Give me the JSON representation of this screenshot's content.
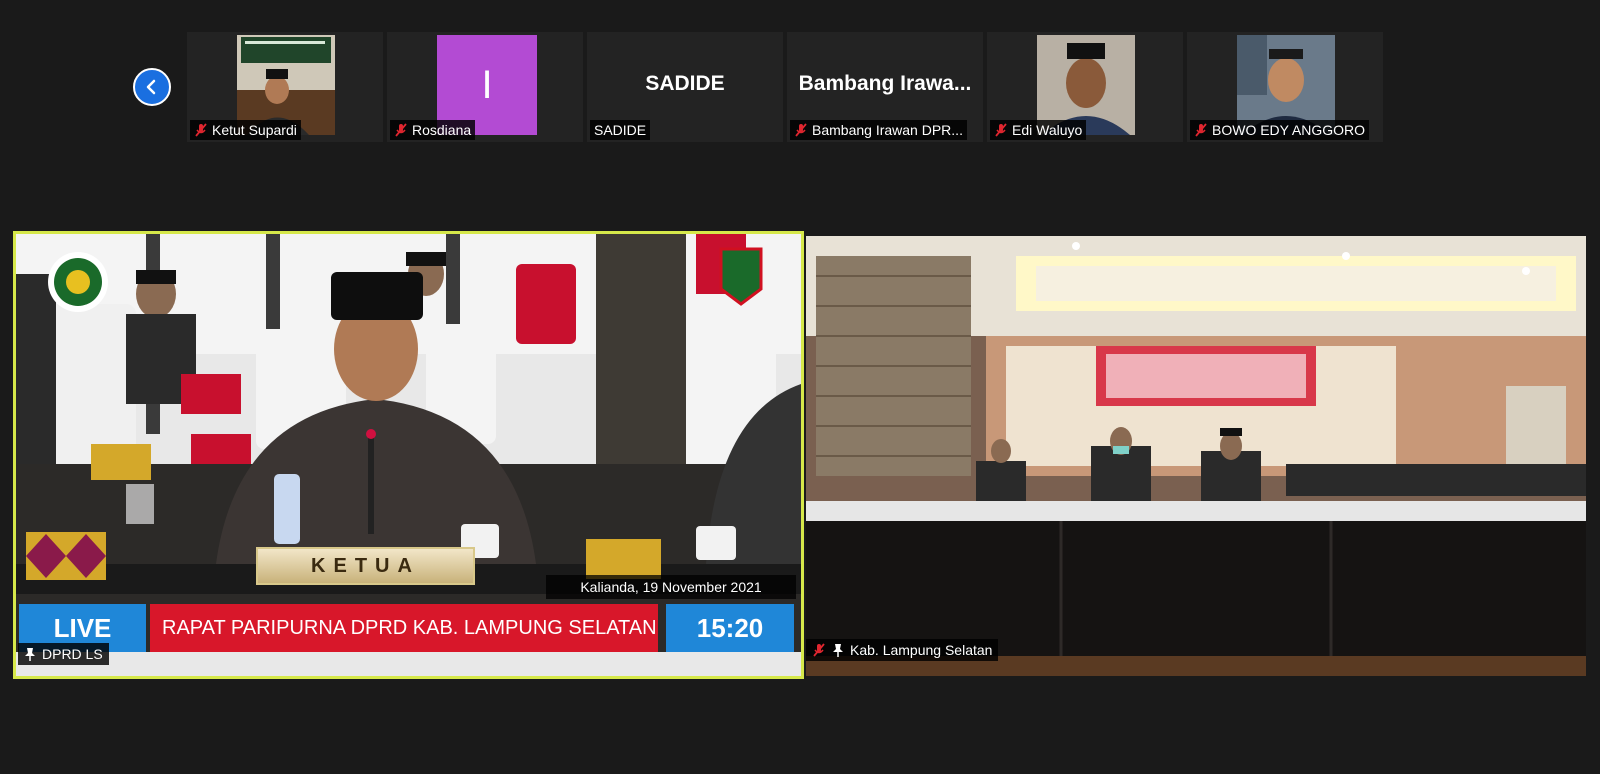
{
  "navigation": {
    "back_icon": "chevron-left-icon"
  },
  "participants": [
    {
      "name": "Ketut Supardi",
      "muted": true
    },
    {
      "name": "Rosdiana",
      "muted": true,
      "avatar_letter": "I",
      "avatar_color": "#b34bd3"
    },
    {
      "name": "SADIDE",
      "muted": false,
      "display_name": "SADIDE"
    },
    {
      "name": "Bambang Irawan DPR...",
      "muted": true,
      "display_name": "Bambang  Irawa..."
    },
    {
      "name": "Edi Waluyo",
      "muted": true
    },
    {
      "name": "BOWO EDY ANGGORO",
      "muted": true
    }
  ],
  "main_left": {
    "label": "DPRD LS",
    "name_plate": "KETUA",
    "date_text": "Kalianda, 19 November 2021",
    "live_text": "LIVE",
    "title_text": "RAPAT PARIPURNA DPRD KAB. LAMPUNG SELATAN",
    "time_text": "15:20",
    "active_speaker_color": "#d6e84a"
  },
  "main_right": {
    "label": "Kab. Lampung Selatan"
  },
  "colors": {
    "background": "#1a1a1a",
    "live_blue": "#1f87d8",
    "title_red": "#d8172a",
    "muted_icon": "#e0262f"
  }
}
